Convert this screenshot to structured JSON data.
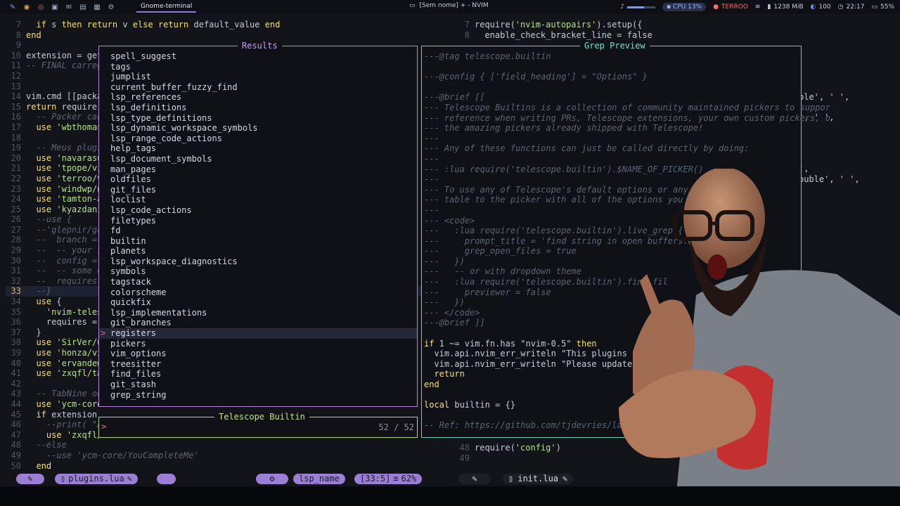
{
  "topbar": {
    "task": "Gnome-terminal",
    "window_title": "[Sem nome] + - NVIM",
    "cpu": "CPU 13%",
    "user": "TERROO",
    "memory": "1238 MiB",
    "brightness": "100",
    "time": "22:17",
    "battery": "55%",
    "volume_level": 0.6
  },
  "left_lines": [
    {
      "n": "7",
      "t": "  if s then return v else return default_value end"
    },
    {
      "n": "8",
      "t": "end"
    },
    {
      "n": "9",
      "t": ""
    },
    {
      "n": "10",
      "t": "extension = get"
    },
    {
      "n": "11",
      "t": "-- FINAL carreg"
    },
    {
      "n": "12",
      "t": ""
    },
    {
      "n": "13",
      "t": ""
    },
    {
      "n": "14",
      "t": "vim.cmd [[packa"
    },
    {
      "n": "15",
      "t": "return require("
    },
    {
      "n": "16",
      "t": "  -- Packer can"
    },
    {
      "n": "17",
      "t": "  use 'wbthomas"
    },
    {
      "n": "18",
      "t": ""
    },
    {
      "n": "19",
      "t": "  -- Meus plugi"
    },
    {
      "n": "20",
      "t": "  use 'navarasu"
    },
    {
      "n": "21",
      "t": "  use 'tpope/vi"
    },
    {
      "n": "22",
      "t": "  use 'terroo/v"
    },
    {
      "n": "23",
      "t": "  use 'windwp/n"
    },
    {
      "n": "24",
      "t": "  use 'tamton-a"
    },
    {
      "n": "25",
      "t": "  use 'kyazdani"
    },
    {
      "n": "26",
      "t": "  --use {"
    },
    {
      "n": "27",
      "t": "  --'glepnir/ga"
    },
    {
      "n": "28",
      "t": "  --  branch ="
    },
    {
      "n": "29",
      "t": "  --  -- your s"
    },
    {
      "n": "30",
      "t": "  --  config ="
    },
    {
      "n": "31",
      "t": "  --  -- some o"
    },
    {
      "n": "32",
      "t": "  --  requires"
    },
    {
      "n": "33",
      "t": "  --}"
    },
    {
      "n": "34",
      "t": "  use {"
    },
    {
      "n": "35",
      "t": "    'nvim-teles"
    },
    {
      "n": "36",
      "t": "    requires ="
    },
    {
      "n": "37",
      "t": "  }"
    },
    {
      "n": "38",
      "t": "  use 'SirVer/u"
    },
    {
      "n": "39",
      "t": "  use 'honza/vi"
    },
    {
      "n": "40",
      "t": "  use 'ervandew"
    },
    {
      "n": "41",
      "t": "  use 'zxqfl/ta"
    },
    {
      "n": "42",
      "t": ""
    },
    {
      "n": "43",
      "t": "  -- TabNine ou"
    },
    {
      "n": "44",
      "t": "  use 'ycm-core"
    },
    {
      "n": "45",
      "t": "  if extension"
    },
    {
      "n": "46",
      "t": "    --print( \"A"
    },
    {
      "n": "47",
      "t": "    use 'zxqfl/"
    },
    {
      "n": "48",
      "t": "  --else"
    },
    {
      "n": "49",
      "t": "    --use 'ycm-core/YouCompleteMe'"
    },
    {
      "n": "50",
      "t": "  end"
    }
  ],
  "right_lines": [
    {
      "n": "7",
      "t": "require('nvim-autopairs').setup({"
    },
    {
      "n": "8",
      "t": "  enable_check_bracket_line = false"
    }
  ],
  "right_fragments": {
    "r1": "ble', ' ',",
    "r2": "', ' ',",
    "r3": "',",
    "r4": "ouble', ' ',"
  },
  "right_bottom": [
    {
      "n": "48",
      "t": "require('config')"
    },
    {
      "n": "49",
      "t": ""
    }
  ],
  "results": {
    "title": "Results",
    "items": [
      "spell_suggest",
      "tags",
      "jumplist",
      "current_buffer_fuzzy_find",
      "lsp_references",
      "lsp_definitions",
      "lsp_type_definitions",
      "lsp_dynamic_workspace_symbols",
      "lsp_range_code_actions",
      "help_tags",
      "lsp_document_symbols",
      "man_pages",
      "oldfiles",
      "git_files",
      "loclist",
      "lsp_code_actions",
      "filetypes",
      "fd",
      "builtin",
      "planets",
      "lsp_workspace_diagnostics",
      "symbols",
      "tagstack",
      "colorscheme",
      "quickfix",
      "lsp_implementations",
      "git_branches",
      "registers",
      "pickers",
      "vim_options",
      "treesitter",
      "find_files",
      "git_stash",
      "grep_string"
    ],
    "selected_index": 27
  },
  "preview": {
    "title": "Grep Preview",
    "lines": [
      {
        "t": "---@tag telescope.builtin",
        "c": true
      },
      {
        "t": "",
        "c": true
      },
      {
        "t": "---@config { ['field_heading'] = \"Options\" }",
        "c": true
      },
      {
        "t": "",
        "c": true
      },
      {
        "t": "---@brief [[",
        "c": true
      },
      {
        "t": "--- Telescope Builtins is a collection of community maintained pickers to suppor",
        "c": true
      },
      {
        "t": "--- reference when writing PRs, Telescope extensions, your own custom pickers, o",
        "c": true
      },
      {
        "t": "--- the amazing pickers already shipped with Telescope!",
        "c": true
      },
      {
        "t": "---",
        "c": true
      },
      {
        "t": "--- Any of these functions can just be called directly by doing:",
        "c": true
      },
      {
        "t": "---",
        "c": true
      },
      {
        "t": "--- :lua require('telescope.builtin').$NAME_OF_PICKER()",
        "c": true
      },
      {
        "t": "---",
        "c": true
      },
      {
        "t": "--- To use any of Telescope's default options or any pic",
        "c": true
      },
      {
        "t": "--- table to the picker with all of the options you wan",
        "c": true
      },
      {
        "t": "---",
        "c": true
      },
      {
        "t": "--- <code>",
        "c": true
      },
      {
        "t": "---   :lua require('telescope.builtin').live_grep({",
        "c": true
      },
      {
        "t": "---     prompt_title = 'find string in open buffers...",
        "c": true
      },
      {
        "t": "---     grep_open_files = true",
        "c": true
      },
      {
        "t": "---   })",
        "c": true
      },
      {
        "t": "---   -- or with dropdown theme",
        "c": true
      },
      {
        "t": "---   :lua require('telescope.builtin').find_fil",
        "c": true
      },
      {
        "t": "---     previewer = false",
        "c": true
      },
      {
        "t": "---   })",
        "c": true
      },
      {
        "t": "--- </code>",
        "c": true
      },
      {
        "t": "---@brief ]]",
        "c": true
      },
      {
        "t": "",
        "c": false
      },
      {
        "t": "if 1 ~= vim.fn.has \"nvim-0.5\" then",
        "c": false
      },
      {
        "t": "  vim.api.nvim_err_writeln \"This plugins",
        "c": false
      },
      {
        "t": "  vim.api.nvim_err_writeln \"Please update",
        "c": false
      },
      {
        "t": "  return",
        "c": false
      },
      {
        "t": "end",
        "c": false
      },
      {
        "t": "",
        "c": false
      },
      {
        "t": "local builtin = {}",
        "c": false
      },
      {
        "t": "",
        "c": false
      },
      {
        "t": "-- Ref: https://github.com/tjdevries/lazy.nvim",
        "c": true
      }
    ]
  },
  "prompt": {
    "title": "Telescope Builtin",
    "caret": ">",
    "count": "52 / 52"
  },
  "statusline": {
    "left_file": "plugins.lua",
    "lsp": "lsp_name",
    "position": "[33:5]",
    "percent": "62%",
    "right_file": "init.lua"
  },
  "colors": {
    "results_border": "#b783e0",
    "preview_border": "#6ecbb9",
    "prompt_border": "#b5d37a",
    "statusline_accent": "#9b7fd4"
  }
}
